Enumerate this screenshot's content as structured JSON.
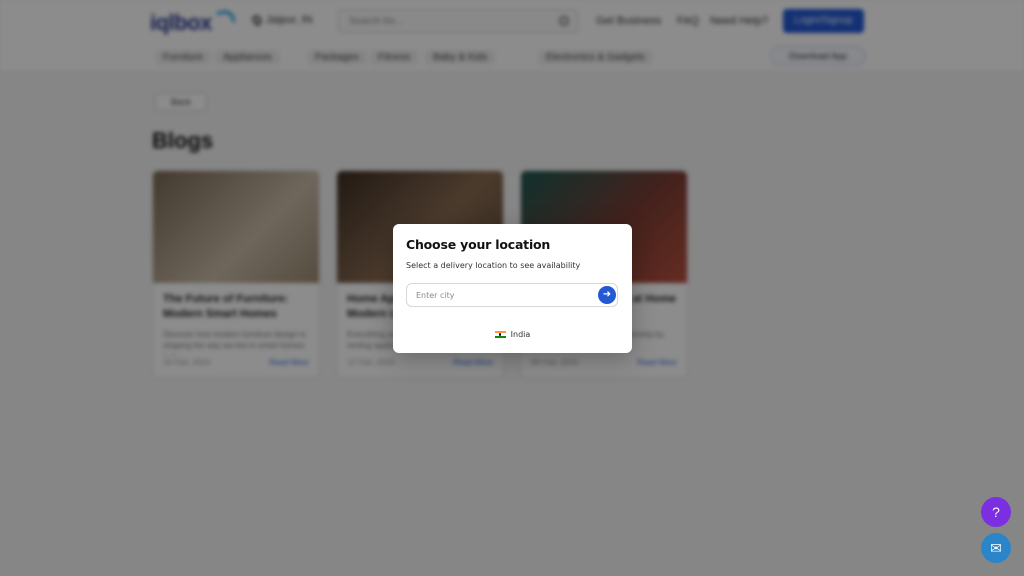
{
  "header": {
    "logo_text": "iqlbox",
    "location_label": "Jaipur, IN",
    "search_placeholder": "Search for...",
    "links": [
      "Get Business",
      "FAQ",
      "Need Help?"
    ],
    "cta_label": "Login/Signup"
  },
  "nav": {
    "items": [
      "Furniture",
      "Appliances",
      "Packages",
      "Fitness",
      "Baby & Kids",
      "Electronics & Gadgets"
    ],
    "pill_label": "Download App"
  },
  "page": {
    "back_label": "Back",
    "title": "Blogs"
  },
  "blogs": [
    {
      "title": "The Future of Furniture: Modern Smart Homes",
      "excerpt": "Discover how modern furniture design is shaping the way we live in smart homes today.",
      "date": "16 Feb, 2024",
      "read_label": "Read More",
      "img_colors": [
        "#7b6a55",
        "#c9bba8"
      ]
    },
    {
      "title": "Home Appliances Guide for Modern Living",
      "excerpt": "Everything you need to know before renting appliances for your new home.",
      "date": "12 Feb, 2024",
      "read_label": "Read More",
      "img_colors": [
        "#3e2f24",
        "#8a6c52"
      ]
    },
    {
      "title": "Fitness Equipment at Home",
      "excerpt": "Stay fit without a gym membership by renting the right equipment.",
      "date": "08 Feb, 2024",
      "read_label": "Read More",
      "img_colors": [
        "#1e5a52",
        "#b8513e"
      ]
    }
  ],
  "modal": {
    "title": "Choose your location",
    "subtitle": "Select a delivery location to see availability",
    "input_placeholder": "Enter city",
    "input_value": "",
    "submit_icon": "arrow-right-icon",
    "country_label": "India",
    "country_flag": "india-flag-icon"
  },
  "fabs": [
    {
      "icon": "help-icon",
      "color": "#7b2fe0"
    },
    {
      "icon": "chat-icon",
      "color": "#2a86c9"
    }
  ],
  "colors": {
    "primary": "#2459d4",
    "overlay": "rgba(0,0,0,0.45)"
  }
}
